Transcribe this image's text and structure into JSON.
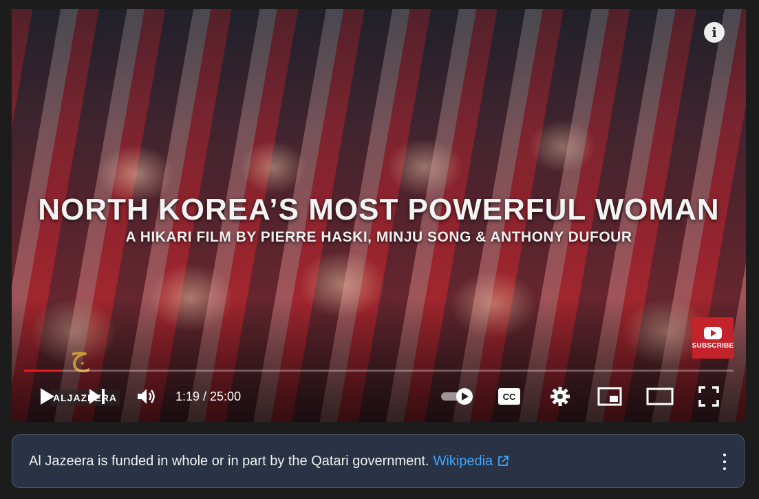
{
  "video": {
    "title_main": "NORTH KOREA’S MOST POWERFUL WOMAN",
    "title_sub": "A HIKARI FILM BY PIERRE HASKI, MINJU SONG & ANTHONY DUFOUR",
    "watermark_text": "ALJAZEERA",
    "subscribe_label": "SUBSCRIBE",
    "info_label": "i",
    "progress_fraction": 0.053
  },
  "controls": {
    "time": "1:19 / 25:00",
    "icons": [
      "play-icon",
      "next-icon",
      "volume-icon",
      "autoplay-toggle",
      "cc-icon",
      "settings-gear-icon",
      "miniplayer-icon",
      "theater-mode-icon",
      "fullscreen-icon"
    ]
  },
  "notice": {
    "text": "Al Jazeera is funded in whole or in part by the Qatari government.",
    "link_label": "Wikipedia"
  },
  "colors": {
    "progress": "#e81c1c",
    "link": "#3ea6ff",
    "notice_bg": "#2a3345",
    "subscribe": "#c4232b"
  }
}
